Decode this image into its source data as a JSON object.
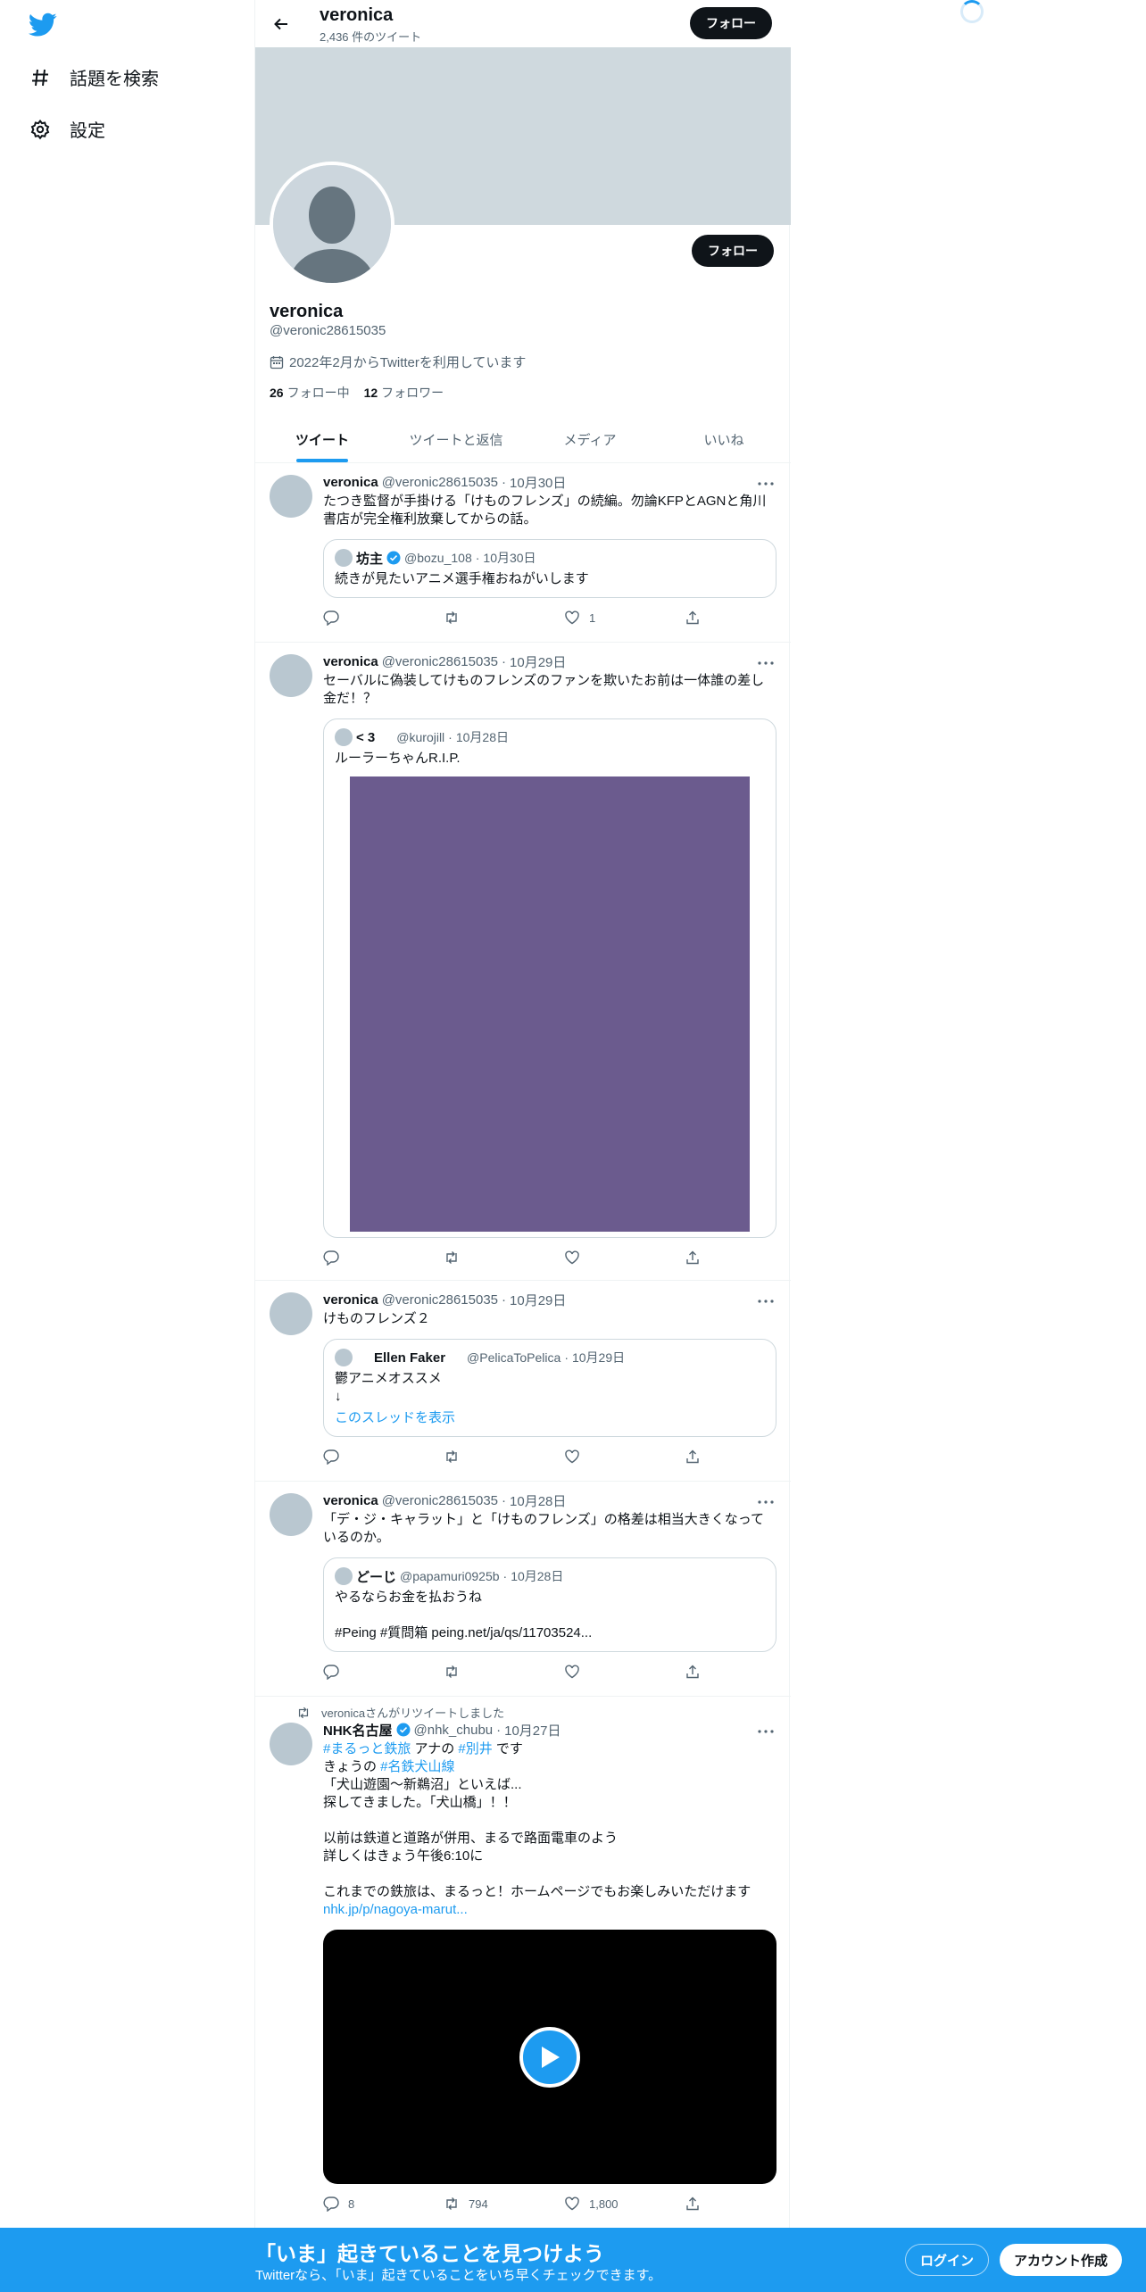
{
  "nav": {
    "items": [
      {
        "label": "話題を検索",
        "icon": "hashtag-icon"
      },
      {
        "label": "設定",
        "icon": "gear-icon"
      }
    ]
  },
  "header": {
    "name": "veronica",
    "tweet_count": "2,436 件のツイート",
    "follow_label": "フォロー"
  },
  "profile": {
    "name": "veronica",
    "handle": "@veronic28615035",
    "joined": "2022年2月からTwitterを利用しています",
    "following_count": "26",
    "following_label": "フォロー中",
    "followers_count": "12",
    "followers_label": "フォロワー",
    "follow_label": "フォロー"
  },
  "tabs": [
    {
      "label": "ツイート",
      "active": true
    },
    {
      "label": "ツイートと返信"
    },
    {
      "label": "メディア"
    },
    {
      "label": "いいね"
    }
  ],
  "tweets": [
    {
      "name": "veronica",
      "handle": "@veronic28615035",
      "date": "10月30日",
      "text": "たつき監督が手掛ける「けものフレンズ」の続編。勿論KFPとAGNと角川書店が完全権利放棄してからの話。",
      "quote": {
        "name": "坊主",
        "handle": "@bozu_108",
        "date": "10月30日",
        "text": "続きが見たいアニメ選手権おねがいします"
      },
      "likes": "1"
    },
    {
      "name": "veronica",
      "handle": "@veronic28615035",
      "date": "10月29日",
      "text": "セーバルに偽装してけものフレンズのファンを欺いたお前は一体誰の差し金だ！？",
      "quote": {
        "name": "< 3",
        "handle": "@kurojill",
        "date": "10月28日",
        "text": "ルーラーちゃんR.I.P."
      }
    },
    {
      "name": "veronica",
      "handle": "@veronic28615035",
      "date": "10月29日",
      "text": "けものフレンズ２",
      "quote": {
        "name": "Ellen Faker",
        "handle": "@PelicaToPelica",
        "date": "10月29日",
        "text": "鬱アニメオススメ\n↓",
        "link": "このスレッドを表示"
      }
    },
    {
      "name": "veronica",
      "handle": "@veronic28615035",
      "date": "10月28日",
      "text": "「デ・ジ・キャラット」と「けものフレンズ」の格差は相当大きくなっているのか。",
      "quote": {
        "name": "どーじ",
        "handle": "@papamuri0925b",
        "date": "10月28日",
        "text": "やるならお金を払おうね\n\n#Peing #質問箱 peing.net/ja/qs/11703524..."
      }
    },
    {
      "retweet_label": "veronicaさんがリツイートしました",
      "name": "NHK名古屋",
      "handle": "@nhk_chubu",
      "date": "10月27日",
      "line1_tag1": "#まるっと鉄旅",
      "line1_mid": " アナの ",
      "line1_tag2": "#別井",
      "line1_end": " です",
      "line2_start": "きょうの ",
      "line2_tag": "#名鉄犬山線",
      "text_rest": "「犬山遊園～新鵜沼」といえば...\n探してきました。「犬山橋」！！\n\n以前は鉄道と道路が併用、まるで路面電車のよう\n詳しくはきょう午後6:10に\n\nこれまでの鉄旅は、まるっと！ホームページでもお楽しみいただけます",
      "url": "nhk.jp/p/nagoya-marut...",
      "replies": "8",
      "retweets": "794",
      "likes": "1,800"
    }
  ],
  "bottom_bar": {
    "title": "「いま」起きていることを見つけよう",
    "subtitle": "Twitterなら、「いま」起きていることをいち早くチェックできます。",
    "login": "ログイン",
    "signup": "アカウント作成"
  },
  "colors": {
    "accent": "#1d9bf0",
    "banner": "#cfd9de",
    "media_placeholder": "#6b5b8e"
  }
}
